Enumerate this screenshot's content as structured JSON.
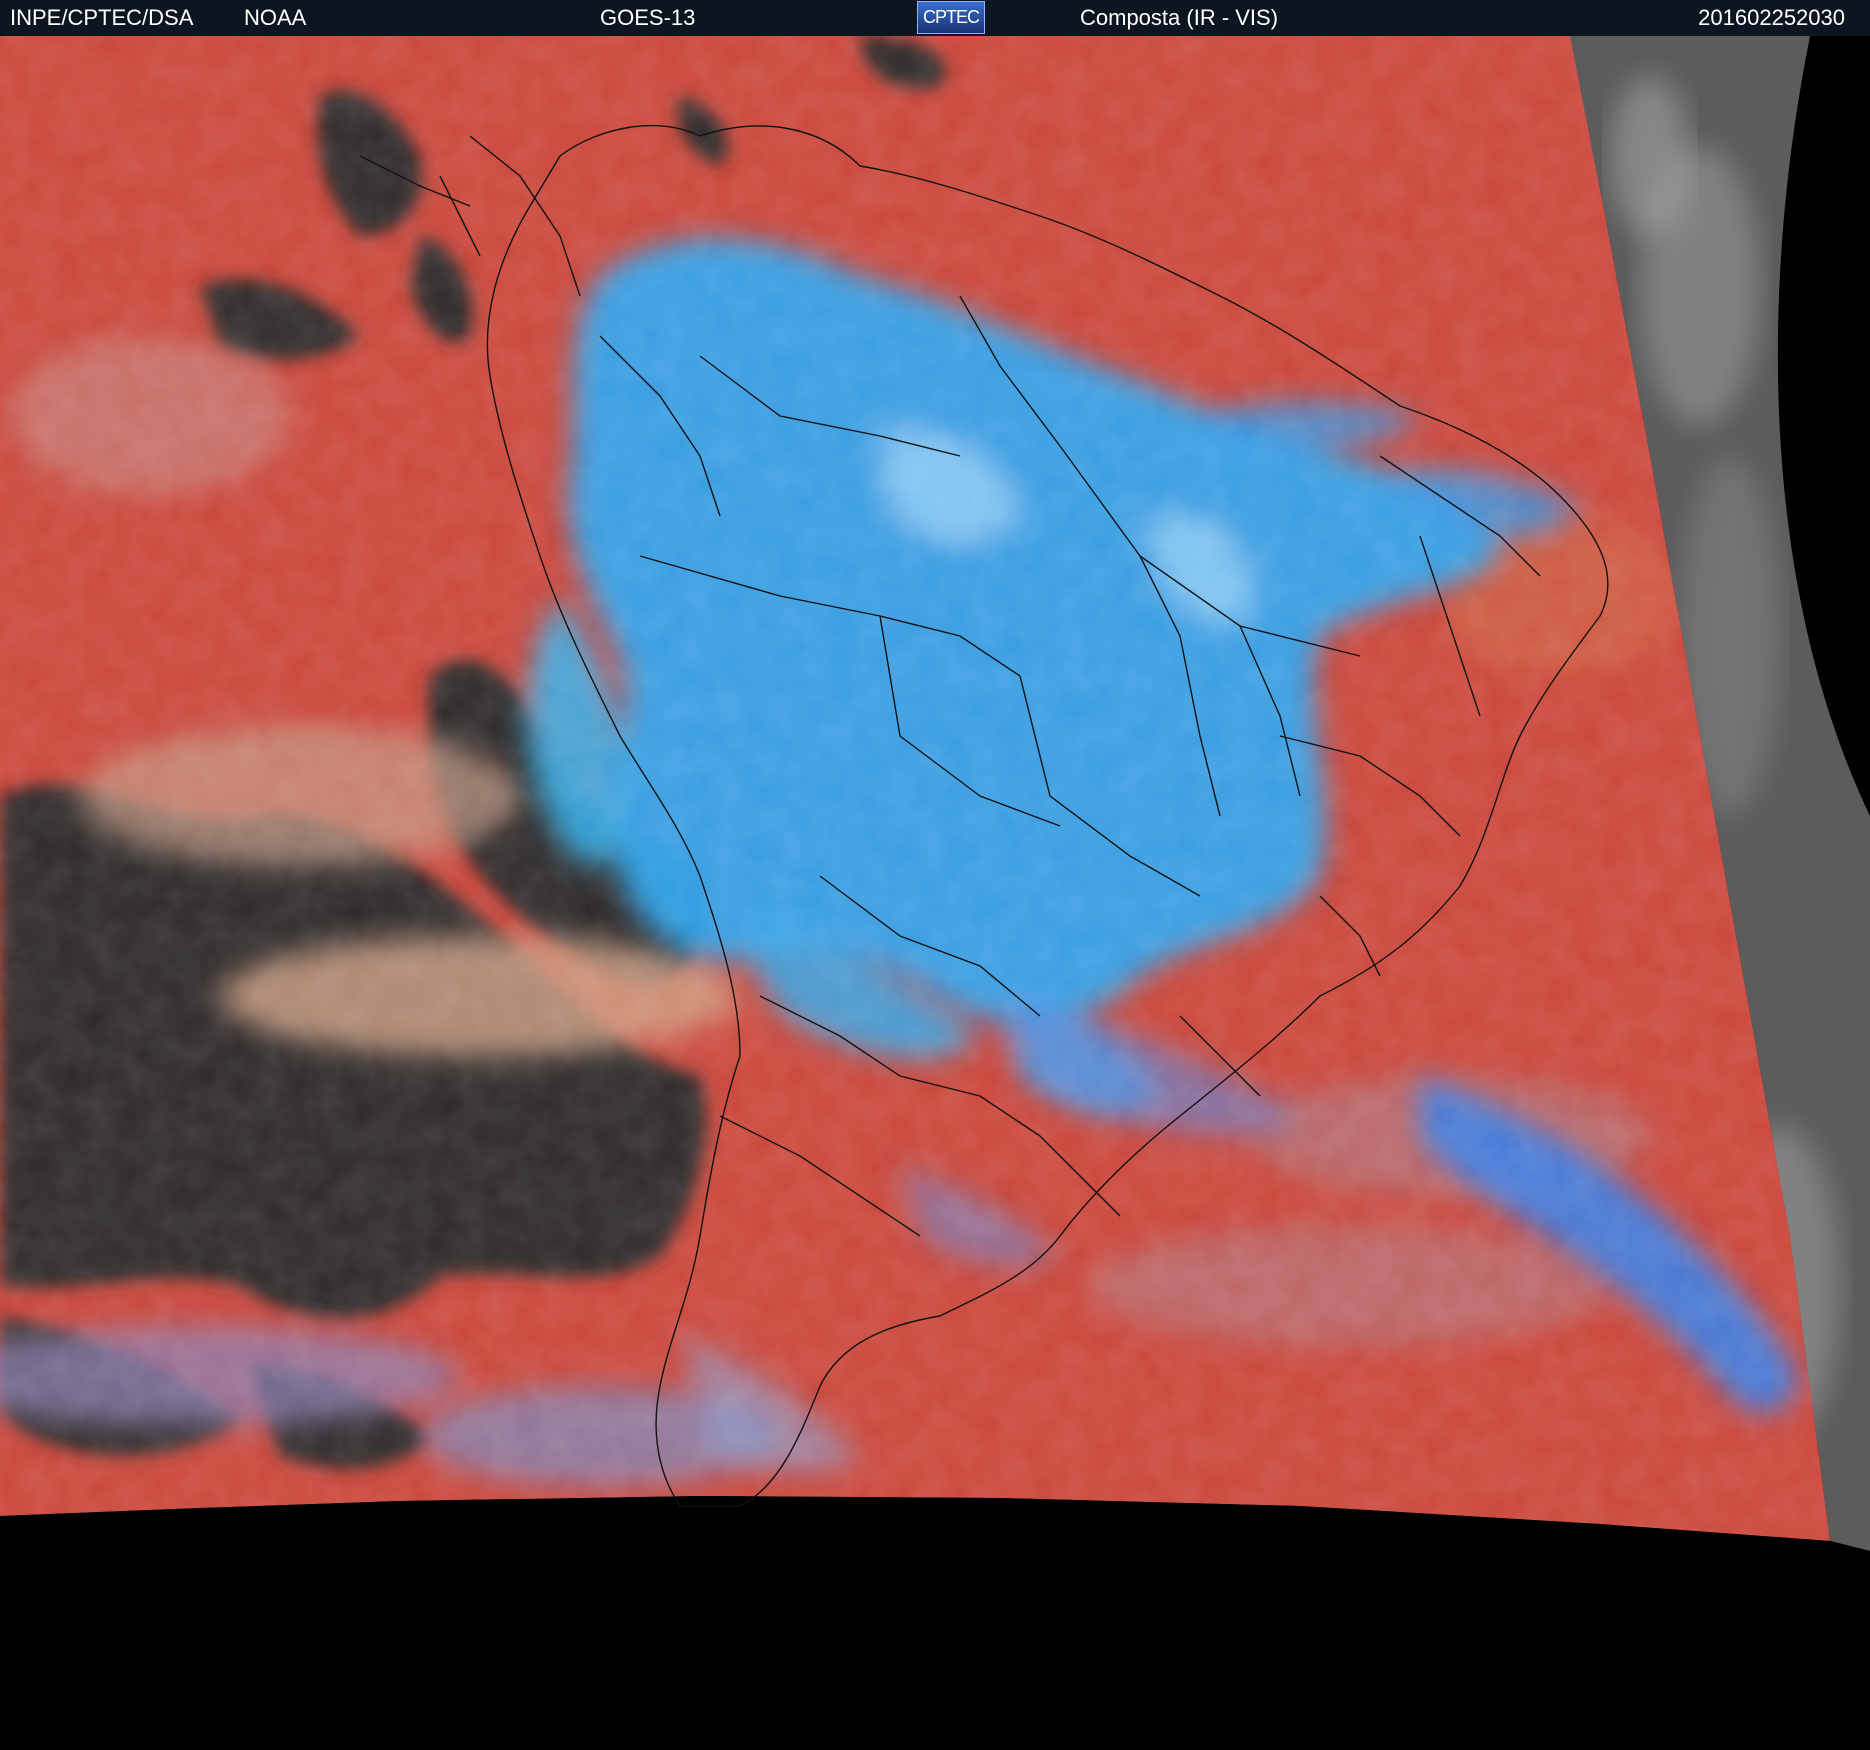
{
  "header": {
    "org": "INPE/CPTEC/DSA",
    "agency": "NOAA",
    "satellite": "GOES-13",
    "logo_text": "CPTEC",
    "product": "Composta (IR - VIS)",
    "timestamp": "201602252030"
  },
  "colors": {
    "header_bg": "#0d1620",
    "clear_sky": "#c8463f",
    "deep_cloud": "#29a9f0",
    "low_cloud_cool": "#2b2b2b",
    "outside_disk": "#000000",
    "visible_only": "#6a6a6a"
  }
}
